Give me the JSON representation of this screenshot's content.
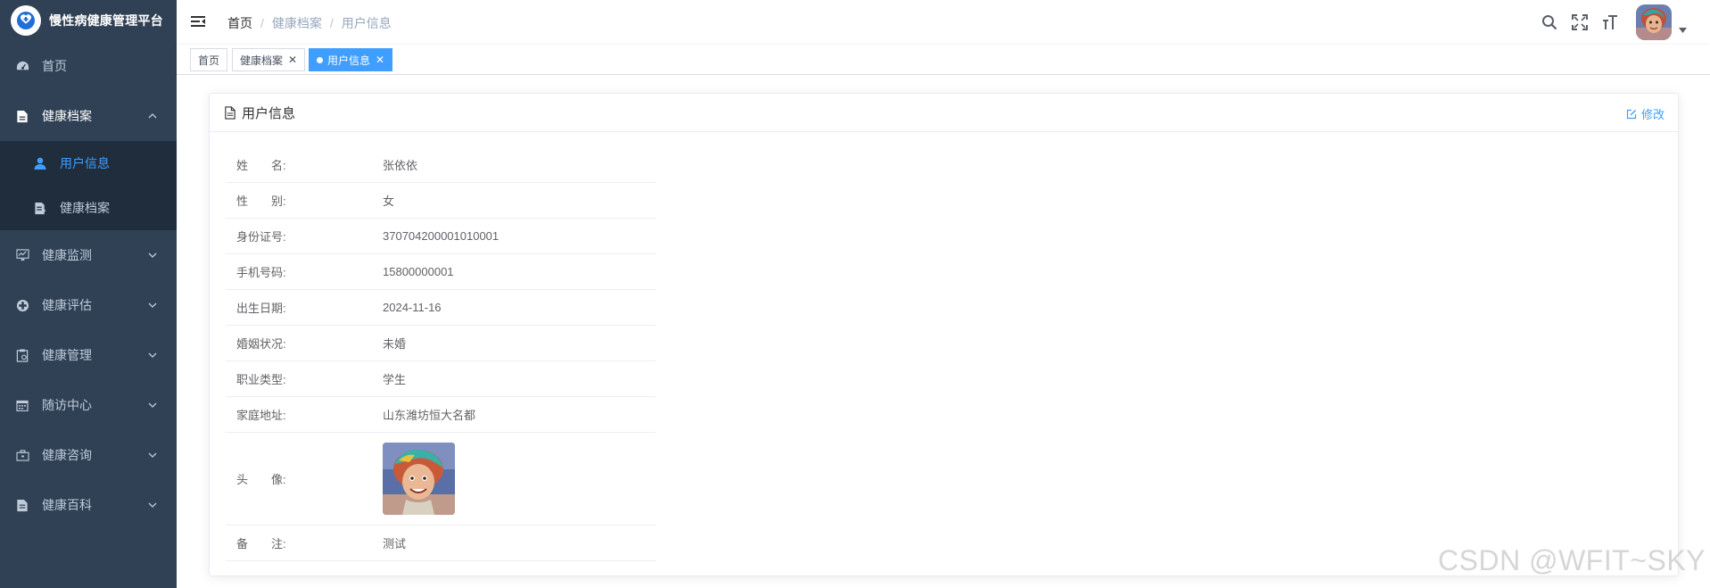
{
  "app": {
    "title": "慢性病健康管理平台"
  },
  "colors": {
    "sidebar_bg": "#304156",
    "submenu_bg": "#1f2d3d",
    "accent": "#409eff",
    "menu_text": "#bfcbd9"
  },
  "sidebar": {
    "items": [
      {
        "label": "首页",
        "icon": "dashboard-icon"
      },
      {
        "label": "健康档案",
        "icon": "document-icon",
        "expanded": true,
        "children": [
          {
            "label": "用户信息",
            "icon": "user-icon",
            "active": true
          },
          {
            "label": "健康档案",
            "icon": "file-edit-icon"
          }
        ]
      },
      {
        "label": "健康监测",
        "icon": "monitor-chart-icon"
      },
      {
        "label": "健康评估",
        "icon": "medical-cross-icon"
      },
      {
        "label": "健康管理",
        "icon": "clipboard-icon"
      },
      {
        "label": "随访中心",
        "icon": "calendar-icon"
      },
      {
        "label": "健康咨询",
        "icon": "briefcase-icon"
      },
      {
        "label": "健康百科",
        "icon": "book-icon"
      }
    ]
  },
  "navbar": {
    "breadcrumb": [
      "首页",
      "健康档案",
      "用户信息"
    ],
    "icons": [
      "search-icon",
      "fullscreen-icon",
      "font-size-icon"
    ]
  },
  "tags": [
    {
      "label": "首页",
      "closable": false,
      "active": false
    },
    {
      "label": "健康档案",
      "closable": true,
      "active": false
    },
    {
      "label": "用户信息",
      "closable": true,
      "active": true
    }
  ],
  "card": {
    "title": "用户信息",
    "edit_label": "修改",
    "rows": [
      {
        "label": "姓　　名:",
        "value": "张依依"
      },
      {
        "label": "性　　别:",
        "value": "女"
      },
      {
        "label": "身份证号:",
        "value": "370704200001010001"
      },
      {
        "label": "手机号码:",
        "value": "15800000001"
      },
      {
        "label": "出生日期:",
        "value": "2024-11-16"
      },
      {
        "label": "婚姻状况:",
        "value": "未婚"
      },
      {
        "label": "职业类型:",
        "value": "学生"
      },
      {
        "label": "家庭地址:",
        "value": "山东潍坊恒大名都"
      },
      {
        "label": "头　　像:",
        "value": ""
      },
      {
        "label": "备　　注:",
        "value": "测试"
      }
    ]
  },
  "watermark": "CSDN @WFIT~SKY"
}
